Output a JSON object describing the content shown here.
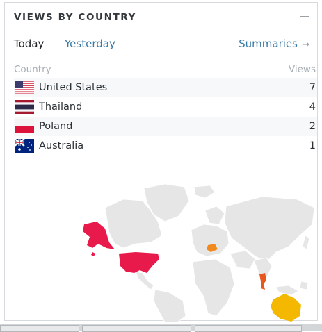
{
  "widget": {
    "title": "VIEWS BY COUNTRY",
    "tabs": {
      "today": "Today",
      "yesterday": "Yesterday",
      "summaries": "Summaries"
    },
    "columns": {
      "country": "Country",
      "views": "Views"
    },
    "rows": [
      {
        "country": "United States",
        "views": "7",
        "flag": "us-flag-icon"
      },
      {
        "country": "Thailand",
        "views": "4",
        "flag": "th-flag-icon"
      },
      {
        "country": "Poland",
        "views": "2",
        "flag": "pl-flag-icon"
      },
      {
        "country": "Australia",
        "views": "1",
        "flag": "au-flag-icon"
      }
    ],
    "map_colors": {
      "United States": "#e8194b",
      "Thailand": "#e8571c",
      "Poland": "#f08a1e",
      "Australia": "#f5b800",
      "other": "#e6e6e6"
    }
  }
}
